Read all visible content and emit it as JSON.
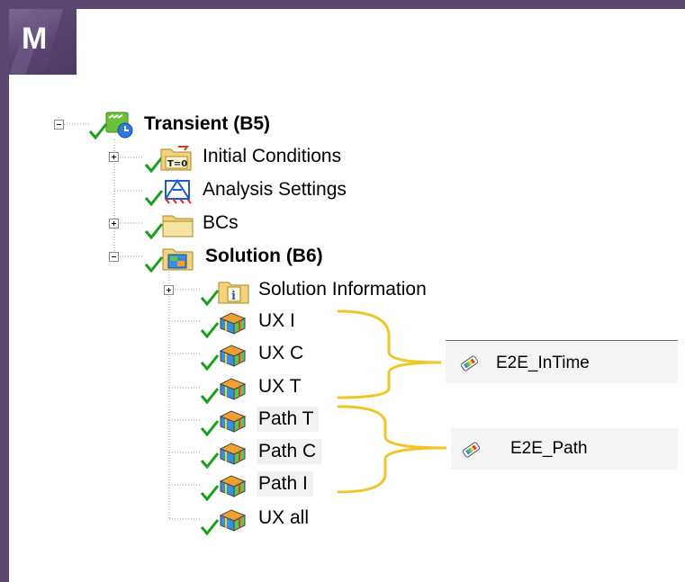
{
  "app": {
    "logo_letter": "M"
  },
  "tree": {
    "root": {
      "label": "Transient (B5)"
    },
    "items": [
      {
        "label": "Initial Conditions"
      },
      {
        "label": "Analysis Settings"
      },
      {
        "label": "BCs"
      }
    ],
    "solution": {
      "label": "Solution (B6)",
      "children": [
        {
          "label": "Solution Information"
        },
        {
          "label": "UX I"
        },
        {
          "label": "UX C"
        },
        {
          "label": "UX T"
        },
        {
          "label": "Path T"
        },
        {
          "label": "Path C"
        },
        {
          "label": "Path I"
        },
        {
          "label": "UX all"
        }
      ]
    }
  },
  "tags": [
    {
      "label": "E2E_InTime"
    },
    {
      "label": "E2E_Path"
    }
  ],
  "colors": {
    "frame": "#5a4870",
    "check": "#17a01a",
    "brace": "#f0c52a",
    "folder": "#f2d37a"
  }
}
